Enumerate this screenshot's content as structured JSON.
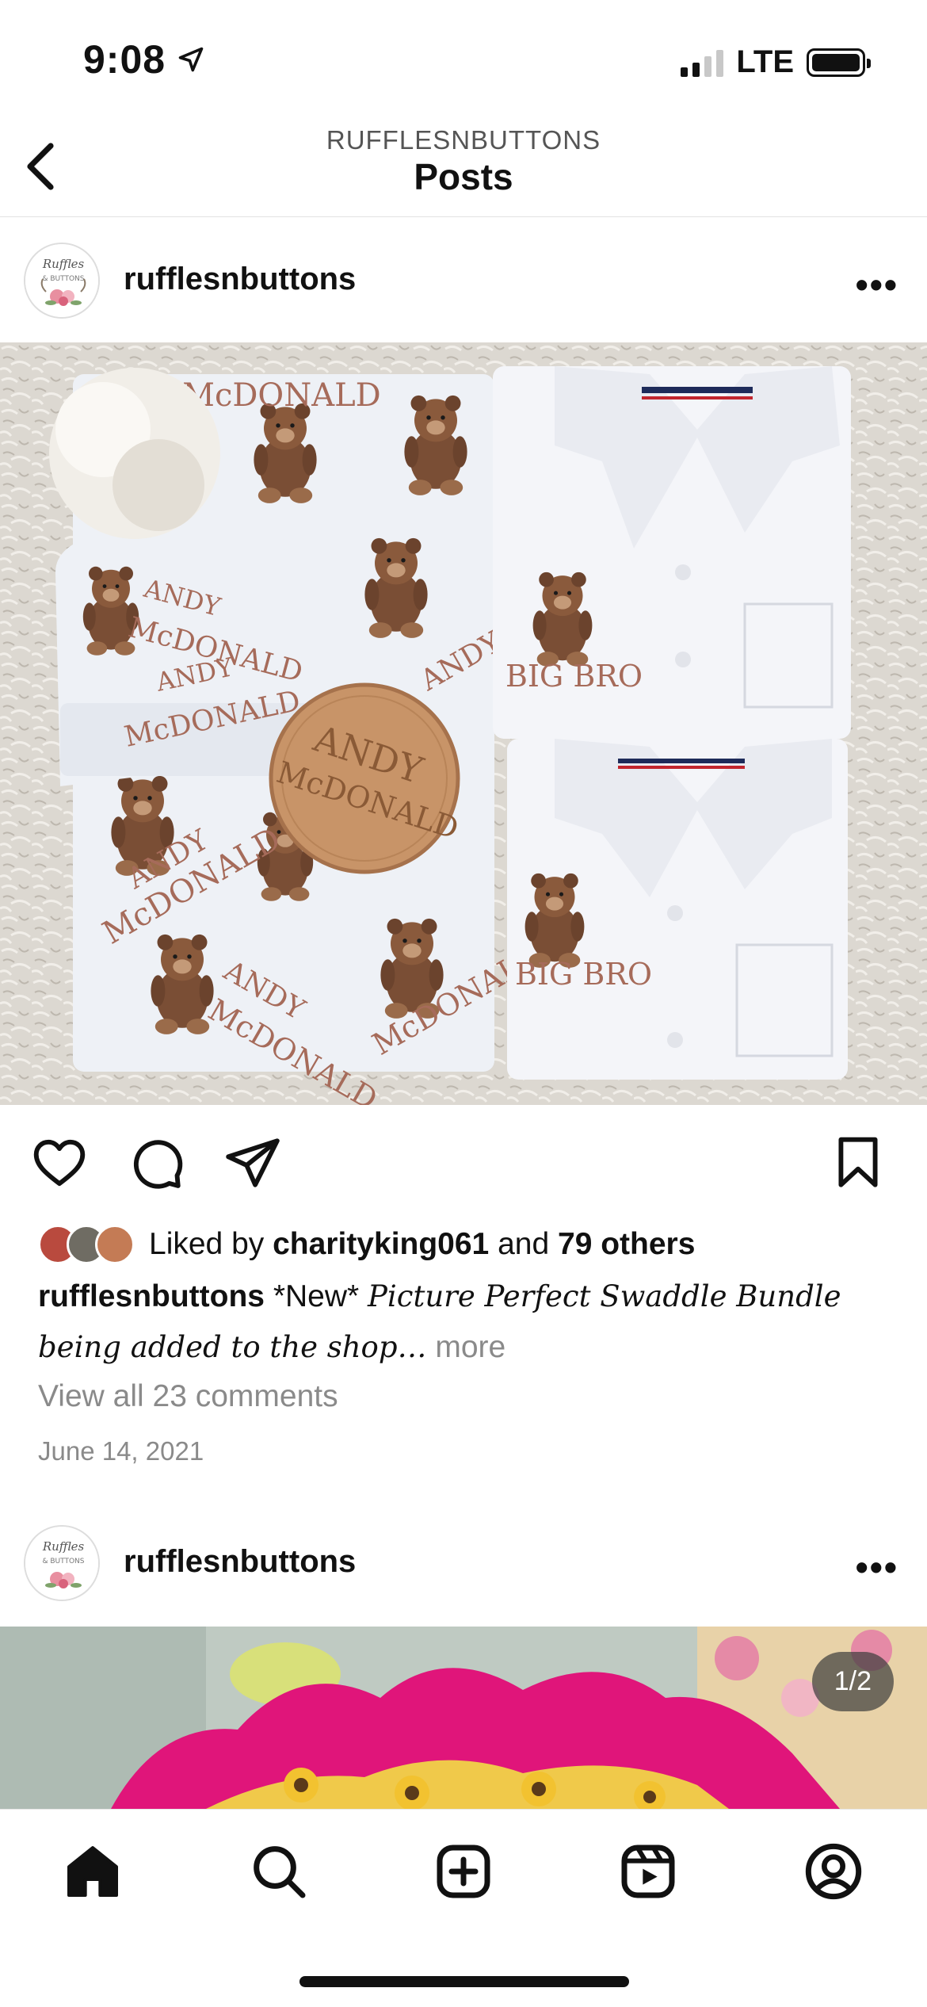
{
  "status_bar": {
    "time": "9:08",
    "network": "LTE"
  },
  "header": {
    "subtitle": "RUFFLESNBUTTONS",
    "title": "Posts"
  },
  "post1": {
    "username": "rufflesnbuttons",
    "image_text": {
      "name_first": "ANDY",
      "name_last": "McDONALD",
      "shirt_label": "BIG BRO",
      "avatar_text_1": "Ruffles",
      "avatar_text_2": "& BUTTONS"
    },
    "likes": {
      "prefix": "Liked by",
      "user": "charityking061",
      "middle": "and",
      "others": "79 others"
    },
    "caption": {
      "user": "rufflesnbuttons",
      "tag": "*New*",
      "text": "Picture Perfect Swaddle Bundle being added to the shop…",
      "more": "more"
    },
    "comments_link": "View all 23 comments",
    "date": "June 14, 2021"
  },
  "post2": {
    "username": "rufflesnbuttons",
    "page_indicator": "1/2"
  },
  "colors": {
    "accent": "#111111",
    "muted": "#8a8a8a",
    "divider": "#e2e2e2"
  }
}
